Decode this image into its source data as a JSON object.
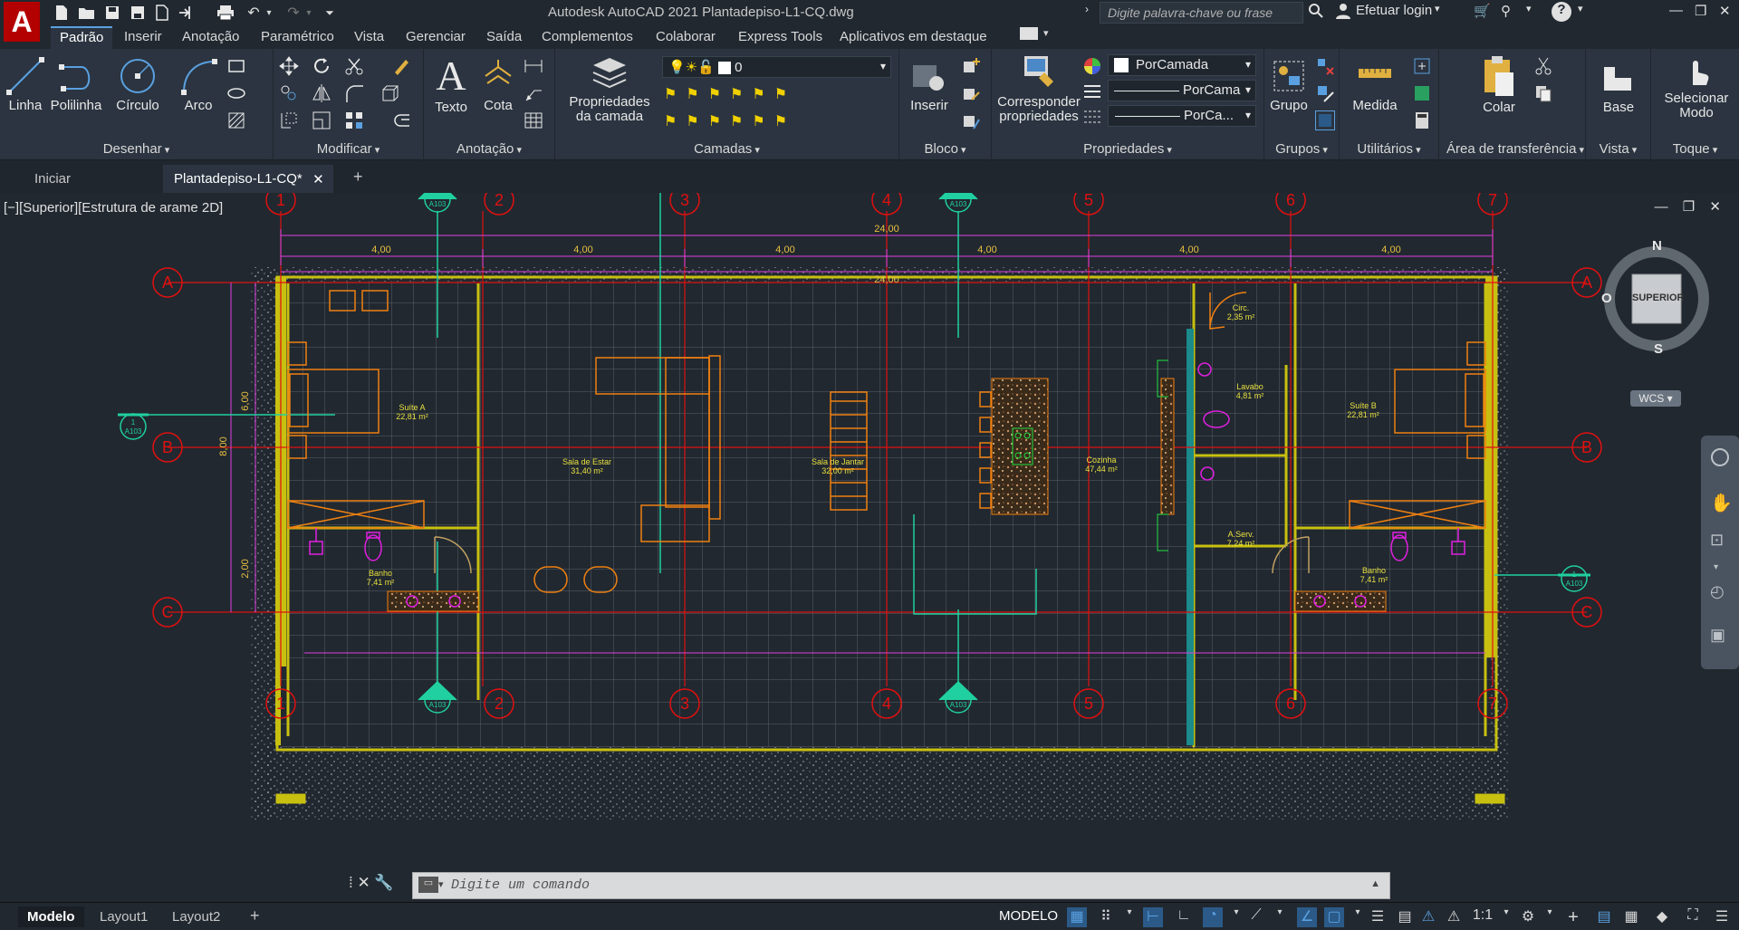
{
  "app": {
    "title": "Autodesk AutoCAD 2021    Plantadepiso-L1-CQ.dwg",
    "logo_letter": "A",
    "search_placeholder": "Digite palavra-chave ou frase",
    "login": "Efetuar login",
    "accent": "#5aa0e0"
  },
  "ribbon_tabs": [
    "Padrão",
    "Inserir",
    "Anotação",
    "Paramétrico",
    "Vista",
    "Gerenciar",
    "Saída",
    "Complementos",
    "Colaborar",
    "Express Tools",
    "Aplicativos em destaque"
  ],
  "panels": {
    "draw": {
      "title": "Desenhar",
      "tools": [
        "Linha",
        "Polilinha",
        "Círculo",
        "Arco"
      ]
    },
    "modify": {
      "title": "Modificar"
    },
    "annotation": {
      "title": "Anotação",
      "tools": [
        "Texto",
        "Cota"
      ]
    },
    "layers": {
      "title": "Camadas",
      "props_label_1": "Propriedades",
      "props_label_2": "da camada",
      "current_layer": "0"
    },
    "block": {
      "title": "Bloco",
      "insert": "Inserir"
    },
    "properties": {
      "title": "Propriedades",
      "match_1": "Corresponder",
      "match_2": "propriedades",
      "color": "PorCamada",
      "linetype": "PorCama",
      "lineweight": "PorCa..."
    },
    "groups": {
      "title": "Grupos",
      "group": "Grupo"
    },
    "utilities": {
      "title": "Utilitários",
      "measure": "Medida"
    },
    "clipboard": {
      "title": "Área de transferência",
      "paste": "Colar"
    },
    "view": {
      "title": "Vista",
      "base": "Base"
    },
    "touch": {
      "title": "Toque",
      "select_1": "Selecionar",
      "select_2": "Modo"
    }
  },
  "doc_tabs": {
    "start": "Iniciar",
    "active": "Plantadepiso-L1-CQ*"
  },
  "viewport": {
    "label": "[−][Superior][Estrutura de arame 2D]",
    "viewcube": {
      "top": "SUPERIOR",
      "n": "N",
      "s": "S",
      "o": "O",
      "wcs": "WCS"
    }
  },
  "plan": {
    "grid_cols": [
      "1",
      "2",
      "3",
      "4",
      "5",
      "6",
      "7"
    ],
    "grid_rows": [
      "A",
      "B",
      "C"
    ],
    "dims_total": "24,00",
    "dims_bays": [
      "4,00",
      "4,00",
      "4,00",
      "4,00",
      "4,00",
      "4,00"
    ],
    "dims_inner_total": "24,00",
    "dims_vertical": [
      "8,00",
      "6,00",
      "2,00"
    ],
    "section_tags": [
      {
        "num": "2",
        "sheet": "A103"
      },
      {
        "num": "3",
        "sheet": "A103"
      },
      {
        "num": "1",
        "sheet": "A103"
      }
    ],
    "rooms": [
      {
        "name": "Suíte A",
        "area": "22,81 m²"
      },
      {
        "name": "Sala de Estar",
        "area": "31,40 m²"
      },
      {
        "name": "Sala de Jantar",
        "area": "32,00 m²"
      },
      {
        "name": "Cozinha",
        "area": "47,44 m²"
      },
      {
        "name": "Circ.",
        "area": "2,35 m²"
      },
      {
        "name": "Lavabo",
        "area": "4,81 m²"
      },
      {
        "name": "Suíte B",
        "area": "22,81 m²"
      },
      {
        "name": "A.Serv.",
        "area": "7,24 m²"
      },
      {
        "name": "Banho",
        "area": "7,41 m²"
      },
      {
        "name": "Banho",
        "area": "7,41 m²"
      }
    ]
  },
  "command": {
    "placeholder": "Digite um comando"
  },
  "status": {
    "layout_tabs": [
      "Modelo",
      "Layout1",
      "Layout2"
    ],
    "space": "MODELO",
    "scale": "1:1"
  }
}
